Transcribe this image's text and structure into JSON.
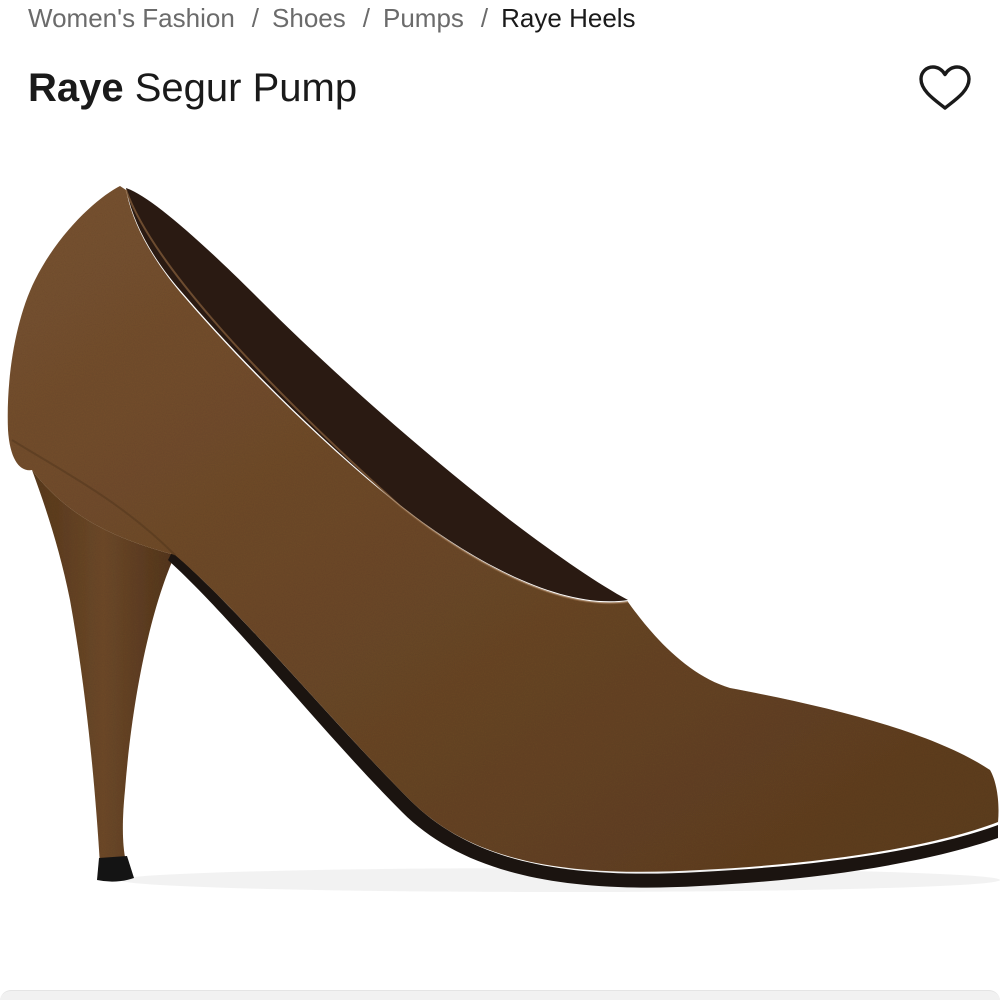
{
  "breadcrumb": {
    "items": [
      {
        "label": "Women's Fashion"
      },
      {
        "label": "Shoes"
      },
      {
        "label": "Pumps"
      },
      {
        "label": "Raye Heels"
      }
    ],
    "separator": "/"
  },
  "product": {
    "brand": "Raye",
    "name": "Segur Pump",
    "image_alt": "Brown suede pointed-toe high heel pump",
    "color_hex": "#6e4a2a"
  },
  "actions": {
    "favorite_icon": "heart-outline-icon"
  }
}
